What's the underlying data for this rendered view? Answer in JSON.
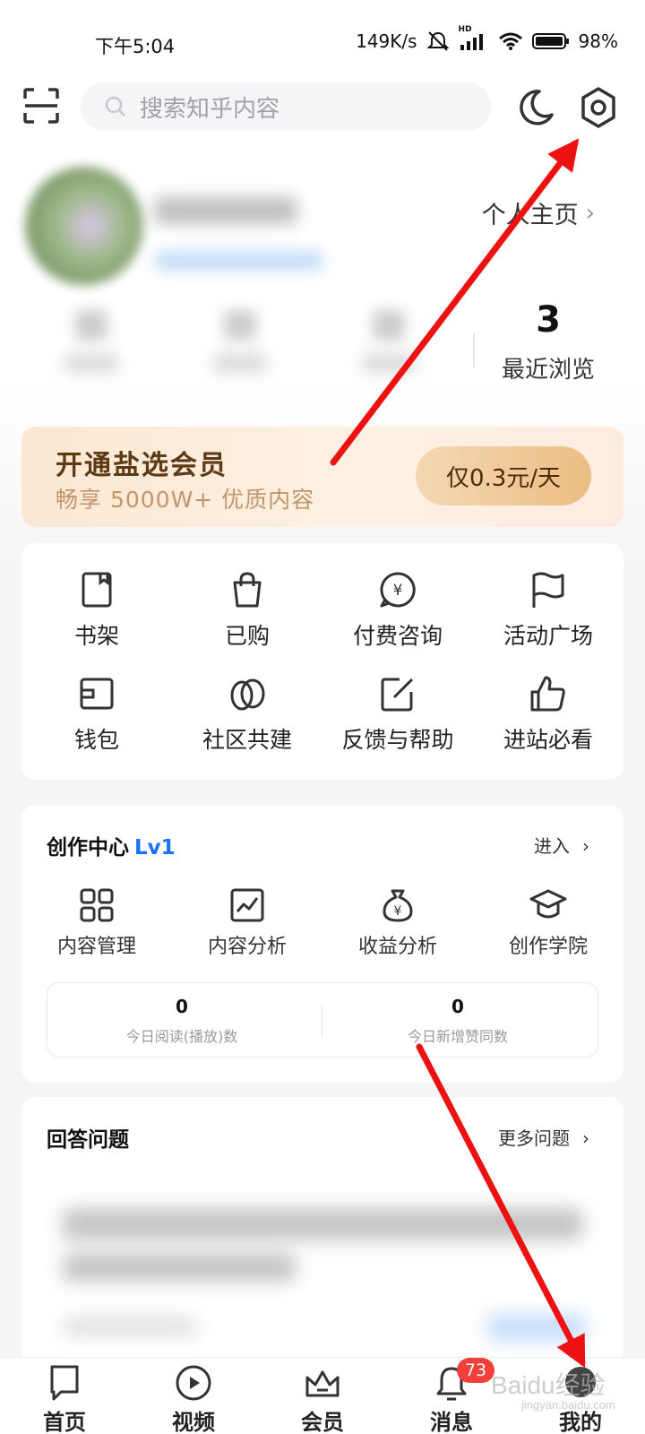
{
  "status_bar": {
    "time": "下午5:04",
    "net_speed": "149K/s",
    "signal_tag": "HD",
    "battery": "98%"
  },
  "header": {
    "search_placeholder": "搜索知乎内容",
    "icons": [
      "scan-icon",
      "search-icon",
      "moon-icon",
      "gear-icon"
    ]
  },
  "profile": {
    "homepage_link": "个人主页",
    "recent_count": "3",
    "recent_label": "最近浏览"
  },
  "vip_banner": {
    "title": "开通盐选会员",
    "subtitle": "畅享 5000W+ 优质内容",
    "button": "仅0.3元/天"
  },
  "services": [
    {
      "label": "书架",
      "icon": "bookshelf-icon"
    },
    {
      "label": "已购",
      "icon": "shopping-bag-icon"
    },
    {
      "label": "付费咨询",
      "icon": "paid-consult-icon"
    },
    {
      "label": "活动广场",
      "icon": "flag-icon"
    },
    {
      "label": "钱包",
      "icon": "wallet-icon"
    },
    {
      "label": "社区共建",
      "icon": "community-icon"
    },
    {
      "label": "反馈与帮助",
      "icon": "feedback-icon"
    },
    {
      "label": "进站必看",
      "icon": "thumbs-up-icon"
    }
  ],
  "creation_center": {
    "title": "创作中心",
    "level": "Lv1",
    "enter": "进入",
    "items": [
      {
        "label": "内容管理",
        "icon": "grid-icon"
      },
      {
        "label": "内容分析",
        "icon": "chart-icon"
      },
      {
        "label": "收益分析",
        "icon": "money-bag-icon"
      },
      {
        "label": "创作学院",
        "icon": "graduation-cap-icon"
      }
    ],
    "stats": [
      {
        "value": "0",
        "label": "今日阅读(播放)数"
      },
      {
        "value": "0",
        "label": "今日新增赞同数"
      }
    ]
  },
  "answer_section": {
    "title": "回答问题",
    "more": "更多问题"
  },
  "bottom_nav": [
    {
      "label": "首页",
      "icon": "home-icon"
    },
    {
      "label": "视频",
      "icon": "video-icon"
    },
    {
      "label": "会员",
      "icon": "crown-icon"
    },
    {
      "label": "消息",
      "icon": "bell-icon",
      "badge": "73"
    },
    {
      "label": "我的",
      "icon": "avatar-icon"
    }
  ],
  "watermark": {
    "brand": "Baidu经验",
    "url": "jingyan.baidu.com"
  },
  "colors": {
    "accent_blue": "#1772f6",
    "badge_red": "#f1403c",
    "arrow_red": "#ee1111",
    "vip_brown": "#5b3a15"
  }
}
